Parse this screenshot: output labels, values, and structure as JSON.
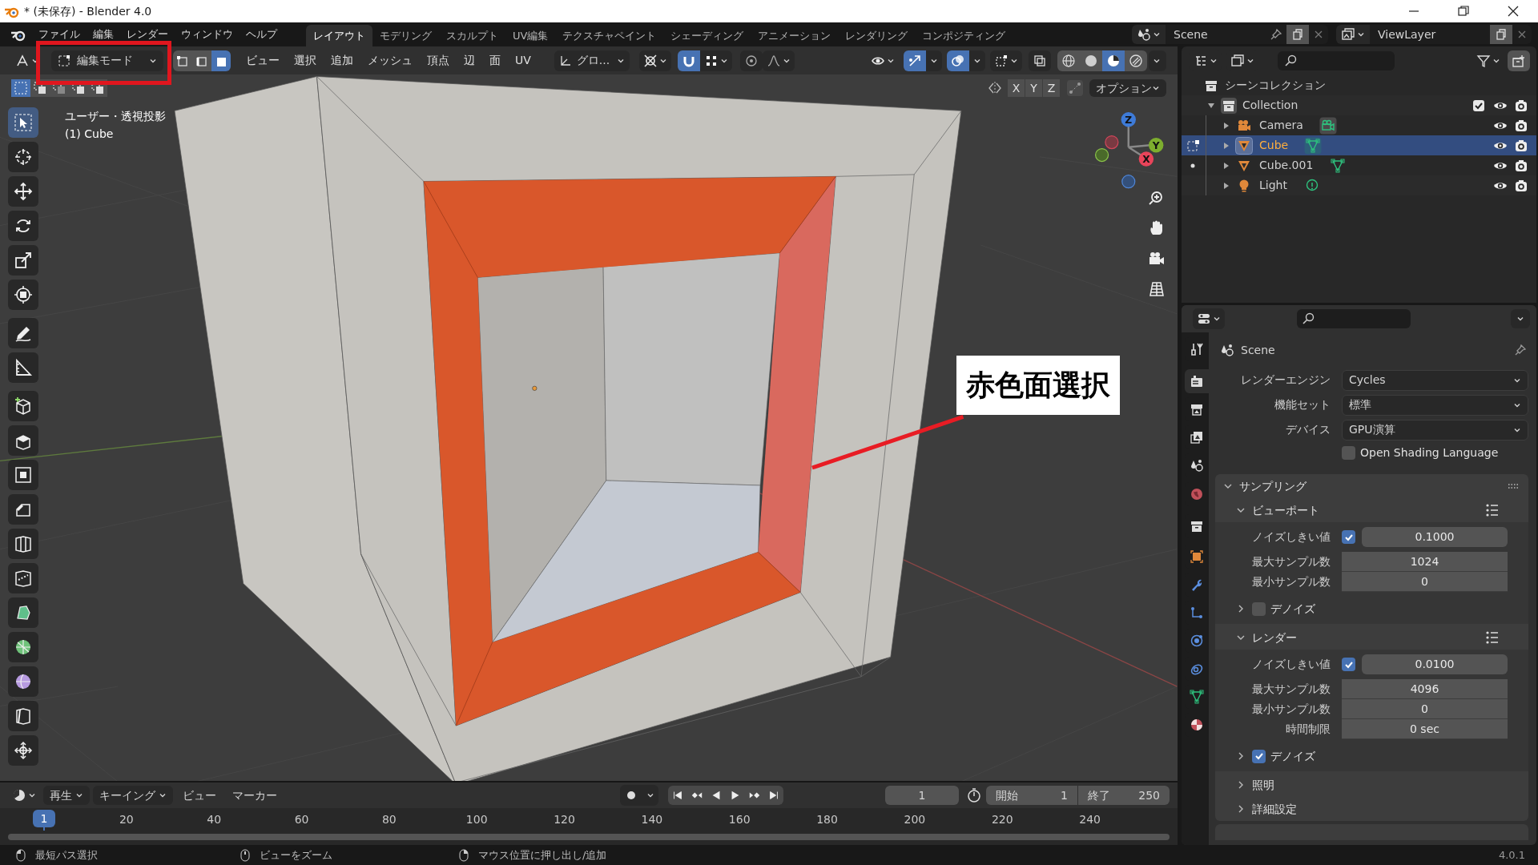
{
  "window": {
    "title": "* (未保存) - Blender 4.0"
  },
  "menu_bar": {
    "menus": [
      "ファイル",
      "編集",
      "レンダー",
      "ウィンドウ",
      "ヘルプ"
    ]
  },
  "workspaces": [
    {
      "label": "レイアウト",
      "selected": true
    },
    {
      "label": "モデリング",
      "selected": false
    },
    {
      "label": "スカルプト",
      "selected": false
    },
    {
      "label": "UV編集",
      "selected": false
    },
    {
      "label": "テクスチャペイント",
      "selected": false
    },
    {
      "label": "シェーディング",
      "selected": false
    },
    {
      "label": "アニメーション",
      "selected": false
    },
    {
      "label": "レンダリング",
      "selected": false
    },
    {
      "label": "コンポジティング",
      "selected": false
    }
  ],
  "scene": {
    "value": "Scene"
  },
  "view_layer": {
    "value": "ViewLayer"
  },
  "viewport": {
    "mode": "編集モード",
    "select_modes": [
      {
        "kind": "vertex",
        "selected": false
      },
      {
        "kind": "edge",
        "selected": false
      },
      {
        "kind": "face",
        "selected": true
      }
    ],
    "menus": [
      "ビュー",
      "選択",
      "追加",
      "メッシュ",
      "頂点",
      "辺",
      "面",
      "UV"
    ],
    "orientation": "グロ...",
    "snap": {
      "on": true
    },
    "proportional": {
      "on": false
    },
    "gizmos": {
      "on": true
    },
    "overlays": {
      "on": true
    },
    "xray": {
      "on": false
    },
    "shading": [
      {
        "kind": "wireframe",
        "selected": false
      },
      {
        "kind": "solid",
        "selected": false
      },
      {
        "kind": "material",
        "selected": true
      },
      {
        "kind": "rendered",
        "selected": false
      }
    ],
    "box_modes": [
      {
        "kind": "set",
        "selected": true
      },
      {
        "kind": "extend",
        "selected": false
      },
      {
        "kind": "subtract",
        "selected": false
      },
      {
        "kind": "invert",
        "selected": false
      },
      {
        "kind": "intersect",
        "selected": false
      }
    ],
    "axes": [
      "X",
      "Y",
      "Z"
    ],
    "options": "オプション",
    "view_name": "ユーザー・透視投影",
    "object_label": "(1) Cube",
    "gizmo": {
      "z": "Z",
      "y": "Y",
      "x": "X"
    },
    "callout": "赤色面選択",
    "tools": [
      {
        "kind": "select",
        "selected": true
      },
      {
        "kind": "cursor",
        "selected": false
      },
      {
        "kind": "move",
        "selected": false
      },
      {
        "kind": "rotate",
        "selected": false
      },
      {
        "kind": "scale",
        "selected": false
      },
      {
        "kind": "transform",
        "selected": false
      },
      {
        "kind": "annotate",
        "selected": false
      },
      {
        "kind": "measure",
        "selected": false
      },
      {
        "kind": "add_cube",
        "selected": false
      },
      {
        "kind": "extrude",
        "selected": false
      },
      {
        "kind": "inset",
        "selected": false
      },
      {
        "kind": "bevel",
        "selected": false
      },
      {
        "kind": "loop_cut",
        "selected": false
      },
      {
        "kind": "knife",
        "selected": false
      },
      {
        "kind": "poly_build",
        "selected": false
      },
      {
        "kind": "spin",
        "selected": false
      },
      {
        "kind": "smooth",
        "selected": false
      },
      {
        "kind": "edge_slide",
        "selected": false
      },
      {
        "kind": "shrink",
        "selected": false
      }
    ]
  },
  "outliner": {
    "root": "シーンコレクション",
    "collection": {
      "label": "Collection",
      "expanded": true,
      "checked": true,
      "children": [
        {
          "label": "Camera",
          "kind": "camera",
          "selected": false,
          "edit_mode": false,
          "editable": false
        },
        {
          "label": "Cube",
          "kind": "mesh",
          "selected": true,
          "edit_mode": true,
          "editable": true
        },
        {
          "label": "Cube.001",
          "kind": "mesh",
          "selected": false,
          "edit_mode": false,
          "editable": true
        },
        {
          "label": "Light",
          "kind": "light",
          "selected": false,
          "edit_mode": false,
          "editable": false
        }
      ]
    }
  },
  "properties": {
    "tabs": [
      {
        "kind": "tool",
        "selected": false
      },
      {
        "kind": "render",
        "selected": true
      },
      {
        "kind": "output",
        "selected": false
      },
      {
        "kind": "view_layer",
        "selected": false
      },
      {
        "kind": "scene",
        "selected": false
      },
      {
        "kind": "world",
        "selected": false
      },
      {
        "kind": "collection",
        "selected": false
      },
      {
        "kind": "object",
        "selected": false
      },
      {
        "kind": "modifiers",
        "selected": false
      },
      {
        "kind": "particles",
        "selected": false
      },
      {
        "kind": "physics",
        "selected": false
      },
      {
        "kind": "constraints",
        "selected": false
      },
      {
        "kind": "data",
        "selected": false
      },
      {
        "kind": "material",
        "selected": false
      }
    ],
    "context": "Scene",
    "fields": [
      {
        "label": "レンダーエンジン",
        "value": "Cycles"
      },
      {
        "label": "機能セット",
        "value": "標準"
      },
      {
        "label": "デバイス",
        "value": "GPU演算"
      }
    ],
    "osl": {
      "label": "Open Shading Language",
      "checked": false
    },
    "sampling": {
      "label": "サンプリング",
      "expanded": true,
      "sections": [
        {
          "label": "ビューポート",
          "expanded": true,
          "rows": [
            {
              "kind": "toggle",
              "label": "ノイズしきい値",
              "checked": true,
              "value": "0.1000"
            },
            {
              "kind": "number",
              "label": "最大サンプル数",
              "value": "1024"
            },
            {
              "kind": "number",
              "label": "最小サンプル数",
              "value": "0"
            }
          ],
          "denoise": {
            "label": "デノイズ",
            "expanded": false,
            "checked": false
          }
        },
        {
          "label": "レンダー",
          "expanded": true,
          "rows": [
            {
              "kind": "toggle",
              "label": "ノイズしきい値",
              "checked": true,
              "value": "0.0100"
            },
            {
              "kind": "number",
              "label": "最大サンプル数",
              "value": "4096"
            },
            {
              "kind": "number",
              "label": "最小サンプル数",
              "value": "0"
            },
            {
              "kind": "number",
              "label": "時間制限",
              "value": "0 sec"
            }
          ],
          "denoise": {
            "label": "デノイズ",
            "expanded": false,
            "checked": true
          }
        },
        {
          "label": "照明",
          "expanded": false
        },
        {
          "label": "詳細設定",
          "expanded": false
        }
      ]
    }
  },
  "timeline": {
    "menus": [
      "再生",
      "キーイング",
      "ビュー",
      "マーカー"
    ],
    "auto_key": {
      "on": false
    },
    "current_frame": "1",
    "start_label": "開始",
    "start": "1",
    "end_label": "終了",
    "end": "250",
    "playhead": "1",
    "ruler": [
      "20",
      "40",
      "60",
      "80",
      "100",
      "120",
      "140",
      "160",
      "180",
      "200",
      "220",
      "240"
    ]
  },
  "status_bar": {
    "hints": [
      {
        "kind": "left",
        "text": "最短パス選択"
      },
      {
        "kind": "middle",
        "text": "ビューをズーム"
      },
      {
        "kind": "right",
        "text": "マウス位置に押し出し/追加"
      }
    ],
    "version": "4.0.1"
  }
}
